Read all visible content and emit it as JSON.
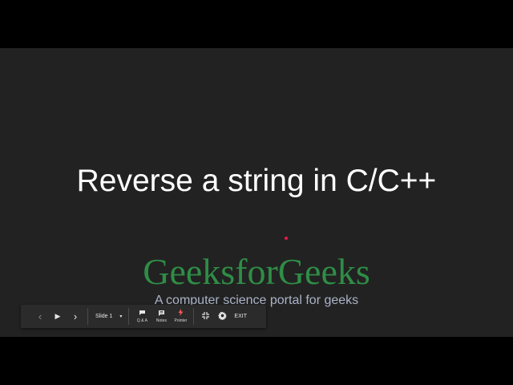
{
  "slide": {
    "title": "Reverse a string in C/C++",
    "brand": "GeeksforGeeks",
    "tagline": "A computer science portal for geeks"
  },
  "toolbar": {
    "prev_icon": "‹",
    "play_icon": "▶",
    "next_icon": "›",
    "slide_label": "Slide 1",
    "dropdown_icon": "▾",
    "qa_label": "Q & A",
    "notes_label": "Notes",
    "pointer_label": "Pointer",
    "exit_label": "EXIT"
  },
  "colors": {
    "slide_bg": "#222222",
    "title": "#ffffff",
    "brand": "#2f8d46",
    "tagline": "#aab4c8",
    "laser": "#e8194a",
    "toolbar_bg": "#2b2b2b"
  },
  "icons": [
    "chevron-left-icon",
    "play-icon",
    "chevron-right-icon",
    "chevron-down-icon",
    "qa-icon",
    "notes-icon",
    "pointer-icon",
    "exit-fullscreen-icon",
    "gear-icon"
  ]
}
